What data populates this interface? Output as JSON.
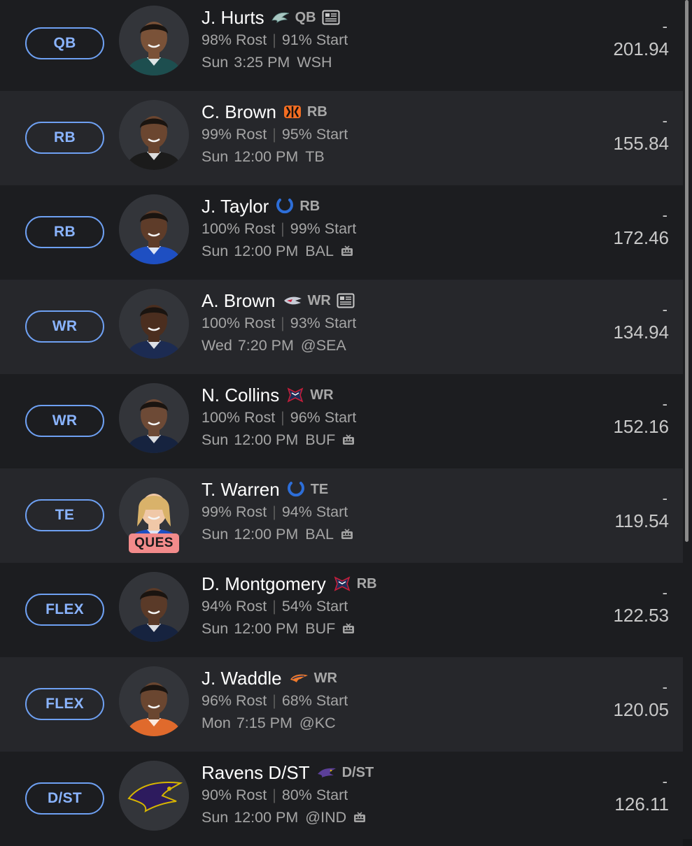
{
  "players": [
    {
      "slot": "QB",
      "name": "J. Hurts",
      "team_logo": "eagles-logo",
      "pos": "QB",
      "news": true,
      "rost": "98% Rost",
      "start": "91% Start",
      "day": "Sun",
      "time": "3:25 PM",
      "opp": "WSH",
      "tv": false,
      "ques": null,
      "dash": "-",
      "proj": "201.94"
    },
    {
      "slot": "RB",
      "name": "C. Brown",
      "team_logo": "bengals-logo",
      "pos": "RB",
      "news": false,
      "rost": "99% Rost",
      "start": "95% Start",
      "day": "Sun",
      "time": "12:00 PM",
      "opp": "TB",
      "tv": false,
      "ques": null,
      "dash": "-",
      "proj": "155.84"
    },
    {
      "slot": "RB",
      "name": "J. Taylor",
      "team_logo": "colts-logo",
      "pos": "RB",
      "news": false,
      "rost": "100% Rost",
      "start": "99% Start",
      "day": "Sun",
      "time": "12:00 PM",
      "opp": "BAL",
      "tv": true,
      "ques": null,
      "dash": "-",
      "proj": "172.46"
    },
    {
      "slot": "WR",
      "name": "A. Brown",
      "team_logo": "patriots-logo",
      "pos": "WR",
      "news": true,
      "rost": "100% Rost",
      "start": "93% Start",
      "day": "Wed",
      "time": "7:20 PM",
      "opp": "@SEA",
      "tv": false,
      "ques": null,
      "dash": "-",
      "proj": "134.94"
    },
    {
      "slot": "WR",
      "name": "N. Collins",
      "team_logo": "texans-logo",
      "pos": "WR",
      "news": false,
      "rost": "100% Rost",
      "start": "96% Start",
      "day": "Sun",
      "time": "12:00 PM",
      "opp": "BUF",
      "tv": true,
      "ques": null,
      "dash": "-",
      "proj": "152.16"
    },
    {
      "slot": "TE",
      "name": "T. Warren",
      "team_logo": "colts-logo",
      "pos": "TE",
      "news": false,
      "rost": "99% Rost",
      "start": "94% Start",
      "day": "Sun",
      "time": "12:00 PM",
      "opp": "BAL",
      "tv": true,
      "ques": "QUES",
      "dash": "-",
      "proj": "119.54"
    },
    {
      "slot": "FLEX",
      "name": "D. Montgomery",
      "team_logo": "texans-logo",
      "pos": "RB",
      "news": false,
      "rost": "94% Rost",
      "start": "54% Start",
      "day": "Sun",
      "time": "12:00 PM",
      "opp": "BUF",
      "tv": true,
      "ques": null,
      "dash": "-",
      "proj": "122.53"
    },
    {
      "slot": "FLEX",
      "name": "J. Waddle",
      "team_logo": "broncos-logo",
      "pos": "WR",
      "news": false,
      "rost": "96% Rost",
      "start": "68% Start",
      "day": "Mon",
      "time": "7:15 PM",
      "opp": "@KC",
      "tv": false,
      "ques": null,
      "dash": "-",
      "proj": "120.05"
    },
    {
      "slot": "D/ST",
      "name": "Ravens D/ST",
      "team_logo": "ravens-logo",
      "pos": "D/ST",
      "news": false,
      "rost": "90% Rost",
      "start": "80% Start",
      "day": "Sun",
      "time": "12:00 PM",
      "opp": "@IND",
      "tv": true,
      "ques": null,
      "dash": "-",
      "proj": "126.11"
    }
  ],
  "colors": {
    "accent": "#6ea0f2",
    "row_dark": "#1c1d20",
    "row_light": "#26272b",
    "ques_badge": "#f28b8b",
    "jersey_eagles": "#1d4e4f",
    "jersey_bengals": "#1b1b1b",
    "jersey_colts": "#1e4fc2",
    "jersey_patriots": "#1c2b52",
    "jersey_texans": "#16233f",
    "jersey_broncos": "#e06a2c"
  }
}
